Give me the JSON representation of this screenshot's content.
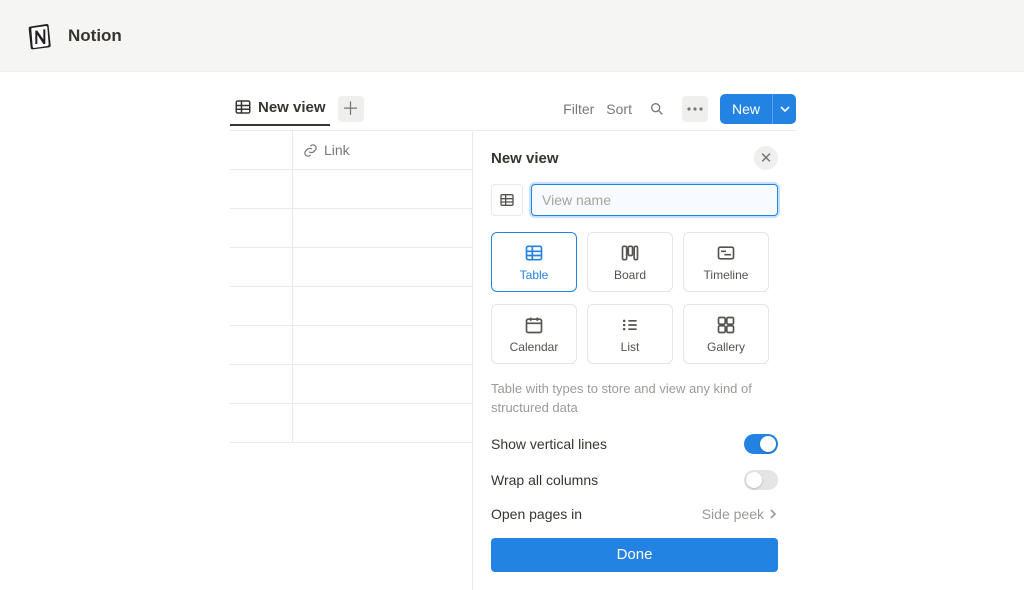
{
  "brand": "Notion",
  "db": {
    "tab_label": "New view",
    "actions": {
      "filter": "Filter",
      "sort": "Sort",
      "new": "New"
    },
    "column_link": "Link"
  },
  "panel": {
    "title": "New view",
    "name_placeholder": "View name",
    "name_value": "",
    "types": [
      {
        "key": "table",
        "label": "Table",
        "selected": true
      },
      {
        "key": "board",
        "label": "Board",
        "selected": false
      },
      {
        "key": "timeline",
        "label": "Timeline",
        "selected": false
      },
      {
        "key": "calendar",
        "label": "Calendar",
        "selected": false
      },
      {
        "key": "list",
        "label": "List",
        "selected": false
      },
      {
        "key": "gallery",
        "label": "Gallery",
        "selected": false
      }
    ],
    "type_desc": "Table with types to store and view any kind of structured data",
    "options": {
      "vertical_lines": {
        "label": "Show vertical lines",
        "on": true
      },
      "wrap_columns": {
        "label": "Wrap all columns",
        "on": false
      },
      "open_pages": {
        "label": "Open pages in",
        "value": "Side peek"
      }
    },
    "done": "Done"
  }
}
